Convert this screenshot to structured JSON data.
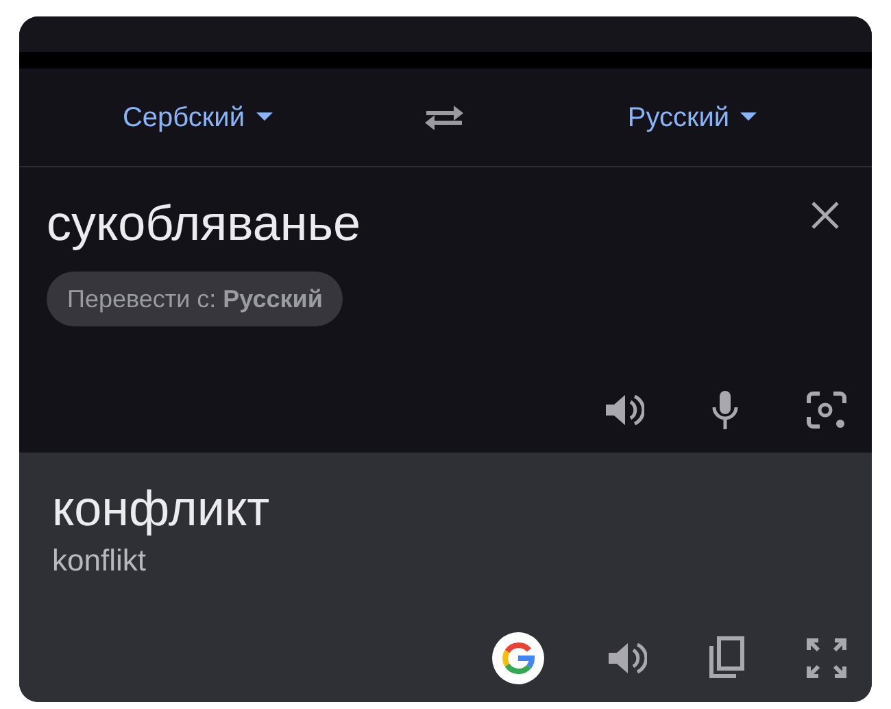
{
  "language_bar": {
    "source_language": "Сербский",
    "target_language": "Русский"
  },
  "input": {
    "text": "сукобляванье",
    "suggestion_chip": "Перевести с: **Русский**"
  },
  "output": {
    "translation": "конфликт",
    "transliteration": "konflikt"
  }
}
